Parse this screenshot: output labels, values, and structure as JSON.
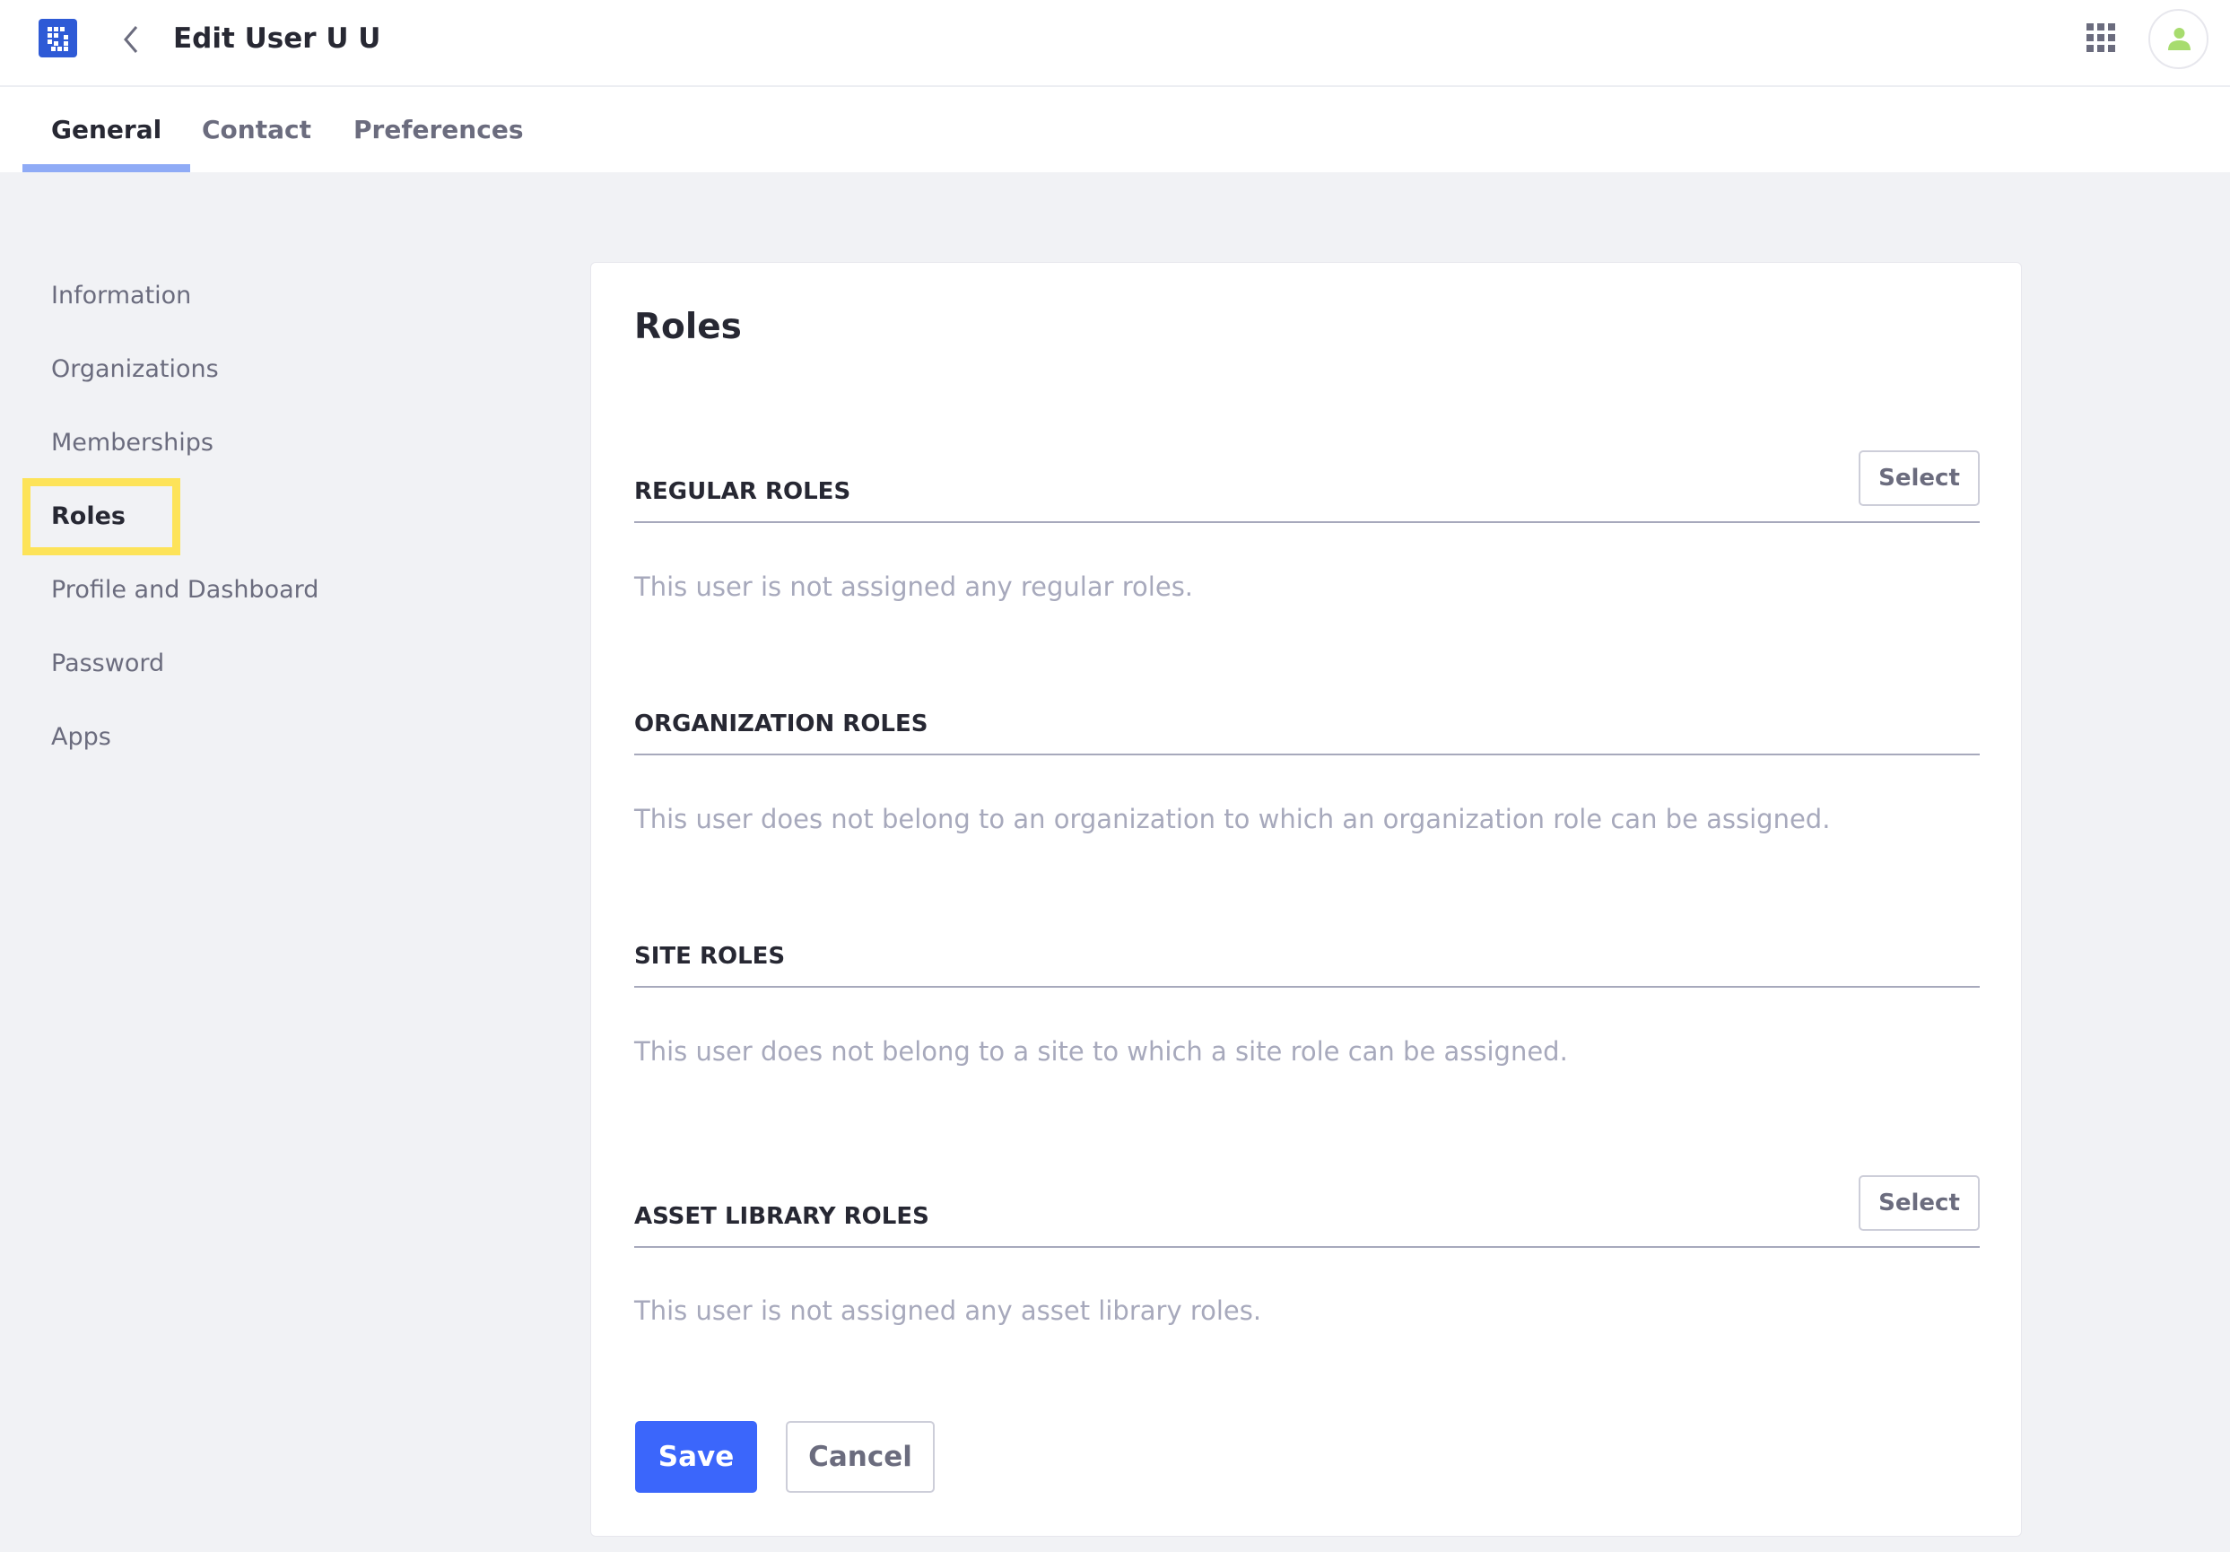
{
  "header": {
    "title": "Edit User U U",
    "logo_icon": "product-logo-icon",
    "back_icon": "chevron-left-icon",
    "apps_icon": "apps-grid-icon",
    "avatar_icon": "user-icon"
  },
  "tabs": [
    {
      "label": "General",
      "active": true
    },
    {
      "label": "Contact",
      "active": false
    },
    {
      "label": "Preferences",
      "active": false
    }
  ],
  "sidebar": {
    "items": [
      {
        "label": "Information"
      },
      {
        "label": "Organizations"
      },
      {
        "label": "Memberships"
      },
      {
        "label": "Roles",
        "active": true
      },
      {
        "label": "Profile and Dashboard"
      },
      {
        "label": "Password"
      },
      {
        "label": "Apps"
      }
    ]
  },
  "main": {
    "title": "Roles",
    "sections": [
      {
        "heading": "REGULAR ROLES",
        "empty_text": "This user is not assigned any regular roles.",
        "button": "Select"
      },
      {
        "heading": "ORGANIZATION ROLES",
        "empty_text": "This user does not belong to an organization to which an organization role can be assigned."
      },
      {
        "heading": "SITE ROLES",
        "empty_text": "This user does not belong to a site to which a site role can be assigned."
      },
      {
        "heading": "ASSET LIBRARY ROLES",
        "empty_text": "This user is not assigned any asset library roles.",
        "button": "Select"
      }
    ],
    "save_label": "Save",
    "cancel_label": "Cancel"
  },
  "colors": {
    "primary": "#3b66fb",
    "highlight": "#fde359",
    "avatar": "#a7dc6e"
  }
}
